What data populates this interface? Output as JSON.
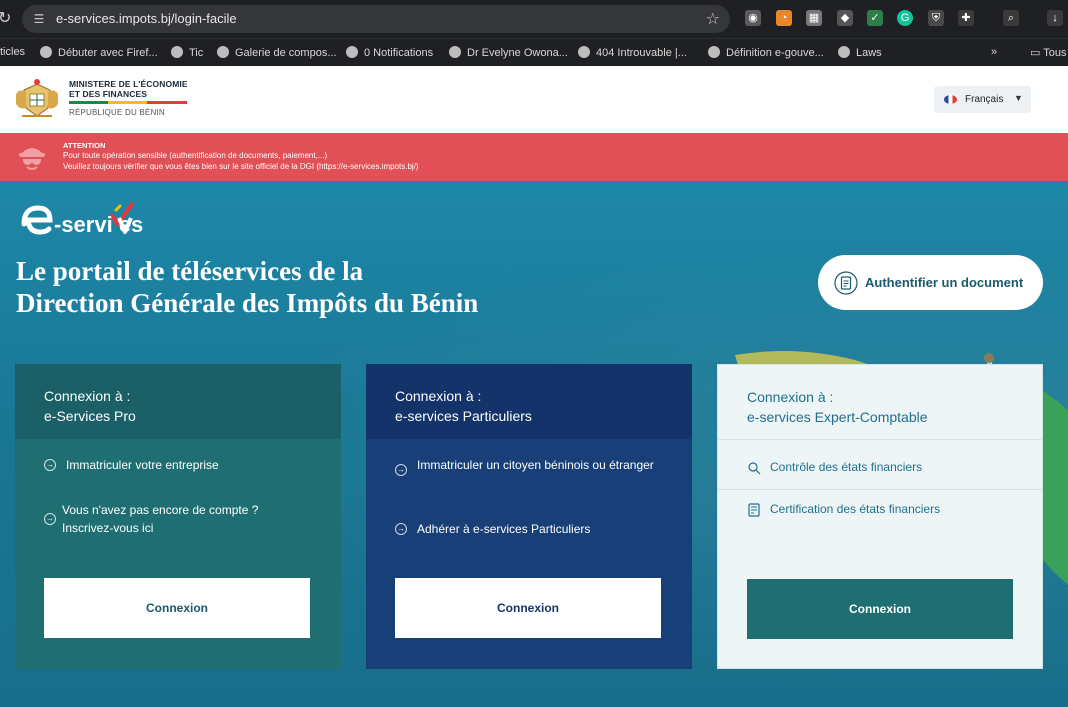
{
  "browser": {
    "url": "e-services.impots.bj/login-facile",
    "bookmarks": [
      {
        "label": "ticles"
      },
      {
        "label": "Débuter avec Firef..."
      },
      {
        "label": "Tic"
      },
      {
        "label": "Galerie de compos..."
      },
      {
        "label": "0 Notifications"
      },
      {
        "label": "Dr Evelyne Owona..."
      },
      {
        "label": "404 Introuvable |..."
      },
      {
        "label": "Définition e-gouve..."
      },
      {
        "label": "Laws"
      },
      {
        "label": "Tous"
      }
    ],
    "overflow": "»"
  },
  "header": {
    "ministry_line1": "MINISTERE DE L'ÉCONOMIE",
    "ministry_line2": "ET DES FINANCES",
    "republic": "RÉPUBLIQUE DU BÉNIN",
    "language": "Français"
  },
  "alert": {
    "title": "ATTENTION",
    "line1": "Pour toute opération sensible (authentification de documents, paiement,...)",
    "line2": "Veuillez toujours vérifier que vous êtes bien sur le site officiel de la DGI (https://e-services.impots.bj/)"
  },
  "hero": {
    "logo": "e-services",
    "headline_line1": "Le portail de téléservices de la",
    "headline_line2": "Direction Générale des Impôts du Bénin",
    "auth_button": "Authentifier un document"
  },
  "cards": [
    {
      "title1": "Connexion à :",
      "title2": "e-Services Pro",
      "items": [
        "Immatriculer votre entreprise",
        "Vous n'avez pas encore de compte ? Inscrivez-vous ici"
      ],
      "button": "Connexion"
    },
    {
      "title1": "Connexion à :",
      "title2": "e-services Particuliers",
      "items": [
        "Immatriculer un citoyen béninois ou étranger",
        "Adhérer à e-services Particuliers"
      ],
      "button": "Connexion"
    },
    {
      "title1": "Connexion à :",
      "title2": "e-services Expert-Comptable",
      "items": [
        "Contrôle des états financiers",
        "Certification des états financiers"
      ],
      "button": "Connexion"
    }
  ],
  "colors": {
    "hero_blue": "#1b7592",
    "alert_red": "#e05056",
    "card_teal": "#1f6f72",
    "card_navy": "#183f78",
    "card_light": "#eef5f7"
  }
}
